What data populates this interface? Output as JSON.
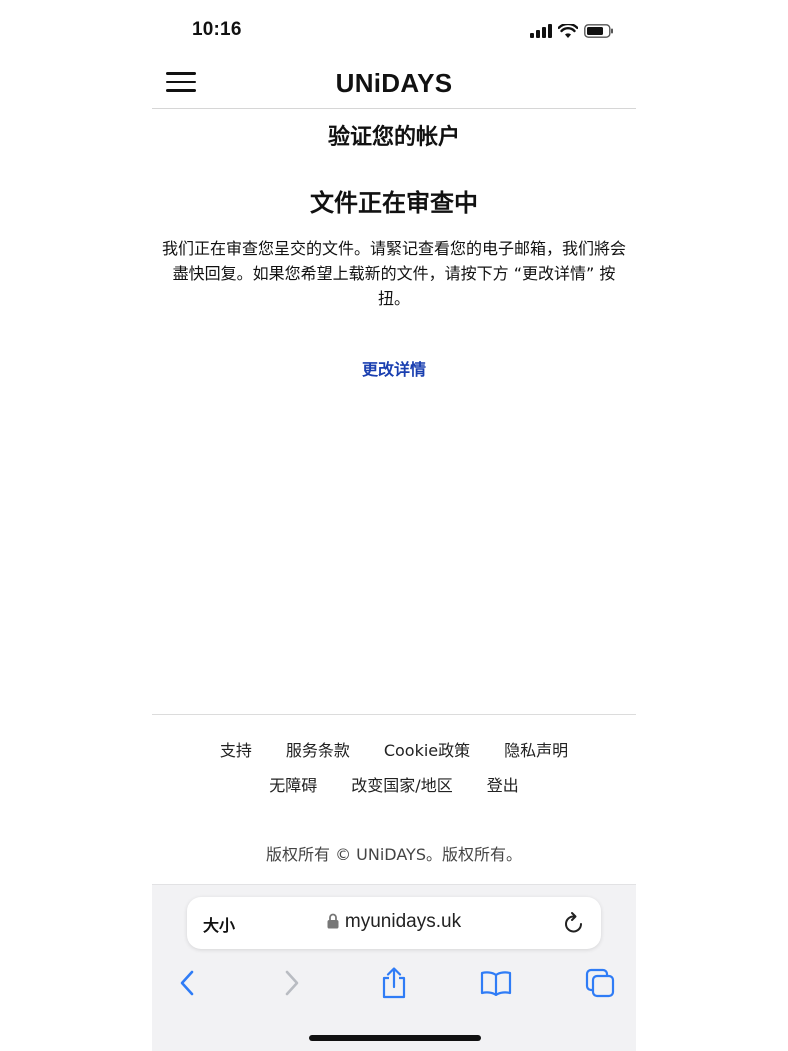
{
  "status_bar": {
    "time": "10:16"
  },
  "header": {
    "logo_text": "UNiDAYS",
    "menu_icon": "hamburger-menu-icon"
  },
  "main": {
    "page_title": "验证您的帐户",
    "section_title": "文件正在审查中",
    "description": "我们正在审查您呈交的文件。请緊记查看您的电子邮箱，我们將会盡快回复。如果您希望上载新的文件，请按下方 “更改详情” 按扭。",
    "change_details_link": "更改详情"
  },
  "footer": {
    "links_row1": [
      "支持",
      "服务条款",
      "Cookie政策",
      "隐私声明"
    ],
    "links_row2": [
      "无障碍",
      "改变国家/地区",
      "登出"
    ],
    "copyright": "版权所有 © UNiDAYS。版权所有。"
  },
  "browser": {
    "text_size_label": "大小",
    "url": "myunidays.uk",
    "icons": [
      "lock-icon",
      "reload-icon",
      "back-icon",
      "forward-icon",
      "share-icon",
      "bookmarks-icon",
      "tabs-icon"
    ]
  },
  "colors": {
    "link": "#1a3fb0",
    "toolbar_bg": "#f2f2f4",
    "icon_blue": "#2f7cf6"
  }
}
